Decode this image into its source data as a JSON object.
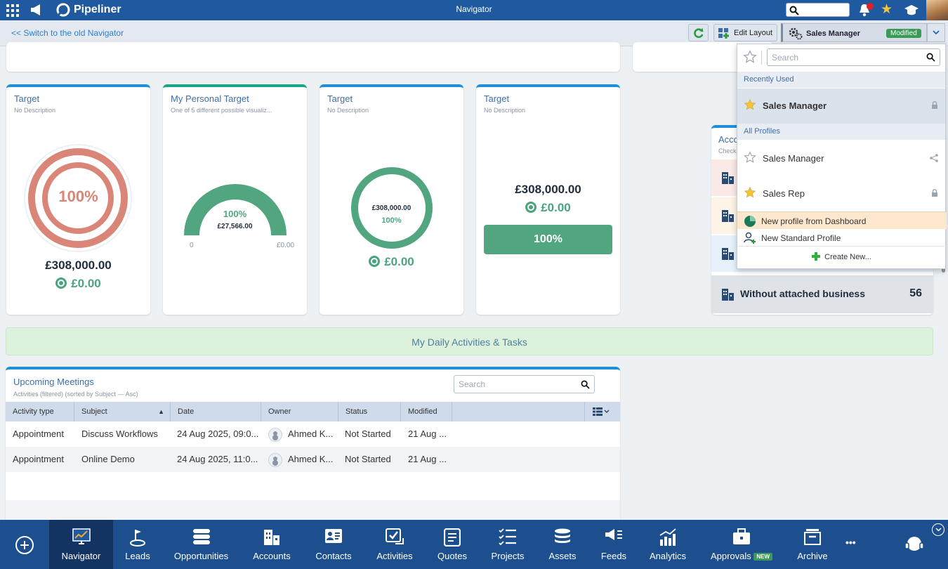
{
  "app": {
    "brand": "Pipeliner",
    "window_title": "Navigator"
  },
  "subbar": {
    "switch_link": "<< Switch to the old Navigator",
    "edit_layout": "Edit Layout",
    "profile_name": "Sales Manager",
    "profile_status": "Modified"
  },
  "cards": [
    {
      "title": "Target",
      "description": "No Description",
      "percent": "100%",
      "amount": "£308,000.00",
      "achieved": "£0.00"
    },
    {
      "title": "My Personal Target",
      "description": "One of 5 different possible visualiz...",
      "percent": "100%",
      "amount": "£27,566.00",
      "min": "0",
      "max": "£0.00"
    },
    {
      "title": "Target",
      "description": "No Description",
      "percent": "100%",
      "amount": "£308,000.00",
      "achieved": "£0.00"
    },
    {
      "title": "Target",
      "description": "No Description",
      "percent": "100%",
      "amount": "£308,000.00",
      "achieved": "£0.00"
    }
  ],
  "accounts_widget": {
    "title_partial": "Acco",
    "subtitle_partial": "Check",
    "without_business_label": "Without attached business",
    "without_business_count": "56"
  },
  "banner": {
    "title": "My Daily Activities & Tasks"
  },
  "meetings": {
    "title": "Upcoming Meetings",
    "subtitle": "Activities (filtered) (sorted by Subject — Asc)",
    "search_placeholder": "Search",
    "columns": [
      "Activity type",
      "Subject",
      "Date",
      "Owner",
      "Status",
      "Modified"
    ],
    "sort_indicator": "▲",
    "rows": [
      {
        "type": "Appointment",
        "subject": "Discuss Workflows",
        "date": "24 Aug 2025, 09:0...",
        "owner": "Ahmed K...",
        "status": "Not Started",
        "modified": "21 Aug ..."
      },
      {
        "type": "Appointment",
        "subject": "Online Demo",
        "date": "24 Aug 2025, 11:0...",
        "owner": "Ahmed K...",
        "status": "Not Started",
        "modified": "21 Aug ..."
      }
    ]
  },
  "profile_dropdown": {
    "search_placeholder": "Search",
    "recently_used_label": "Recently Used",
    "recent": [
      {
        "name": "Sales Manager",
        "icon": "lock-icon"
      }
    ],
    "all_profiles_label": "All Profiles",
    "profiles": [
      {
        "name": "Sales Manager",
        "icon": "share-icon"
      },
      {
        "name": "Sales Rep",
        "icon": "lock-icon"
      }
    ],
    "actions": [
      "New profile from Dashboard",
      "New Standard Profile"
    ],
    "create_new": "Create New..."
  },
  "bottom_nav": {
    "items": [
      "Navigator",
      "Leads",
      "Opportunities",
      "Accounts",
      "Contacts",
      "Activities",
      "Quotes",
      "Projects",
      "Assets",
      "Feeds",
      "Analytics",
      "Approvals",
      "Archive"
    ],
    "active": "Navigator",
    "approvals_badge": "NEW",
    "more": "•••"
  },
  "colors": {
    "top_bar": "#1f5aa0",
    "bottom_nav": "#1d4f8f",
    "accent_green": "#4aa57e",
    "ring_red": "#d98577",
    "banner_bg": "#dcf2dc"
  }
}
